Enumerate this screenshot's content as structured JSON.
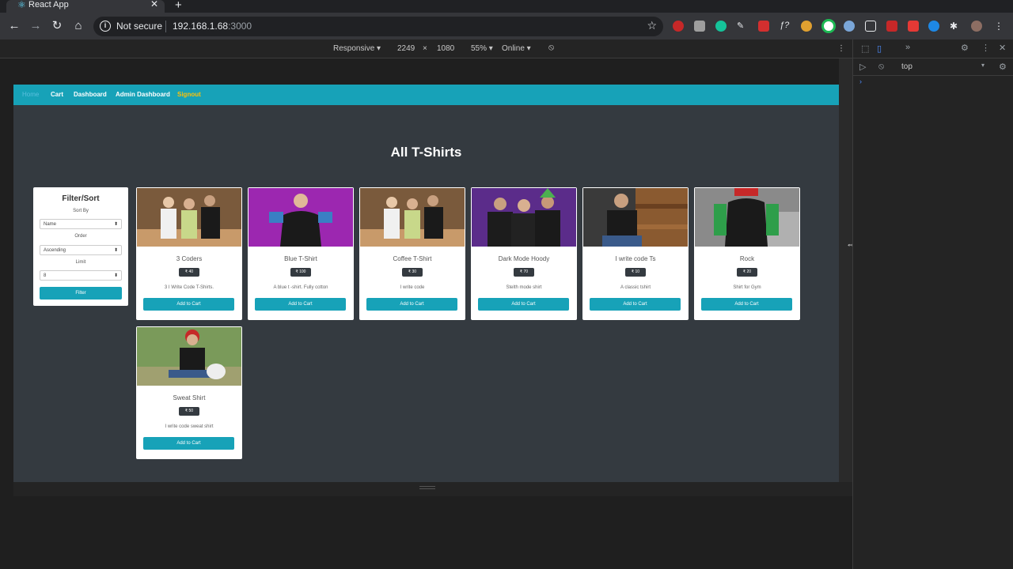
{
  "browser": {
    "tab_title": "React App",
    "omnibox": {
      "security": "Not secure",
      "host": "192.168.1.68",
      "port": ":3000"
    }
  },
  "device_toolbar": {
    "mode": "Responsive ▾",
    "width": "2249",
    "x": "×",
    "height": "1080",
    "zoom": "55% ▾",
    "network": "Online ▾"
  },
  "devtools": {
    "context": "top",
    "prompt": "›"
  },
  "navbar": {
    "links": [
      {
        "label": "Home",
        "state": "active"
      },
      {
        "label": "Cart"
      },
      {
        "label": "Dashboard"
      },
      {
        "label": "Admin Dashboard"
      },
      {
        "label": "Signout"
      }
    ],
    "color": "#17a2b8"
  },
  "page": {
    "title": "All T-Shirts",
    "background": "#343a40"
  },
  "filter": {
    "title": "Filter/Sort",
    "sort_label": "Sort By",
    "sort_value": "Name",
    "order_label": "Order",
    "order_value": "Ascending",
    "limit_label": "Limit",
    "limit_value": "8",
    "button": "Filter"
  },
  "products": [
    {
      "name": "3 Coders",
      "price": "₹ 40",
      "description": "3 I Write Code T-Shirts.",
      "button": "Add to Cart"
    },
    {
      "name": "Blue T-Shirt",
      "price": "₹ 100",
      "description": "A blue t -shirt. Fully cotton",
      "button": "Add to Cart"
    },
    {
      "name": "Coffee T-Shirt",
      "price": "₹ 30",
      "description": "I write code",
      "button": "Add to Cart"
    },
    {
      "name": "Dark Mode Hoody",
      "price": "₹ 70",
      "description": "Stelth mode shirt",
      "button": "Add to Cart"
    },
    {
      "name": "I write code Ts",
      "price": "₹ 10",
      "description": "A classic tshirt",
      "button": "Add to Cart"
    },
    {
      "name": "Rock",
      "price": "₹ 20",
      "description": "Shirt for Gym",
      "button": "Add to Cart"
    },
    {
      "name": "Sweat Shirt",
      "price": "₹ 50",
      "description": "I write code sweat shirt",
      "button": "Add to Cart"
    }
  ]
}
